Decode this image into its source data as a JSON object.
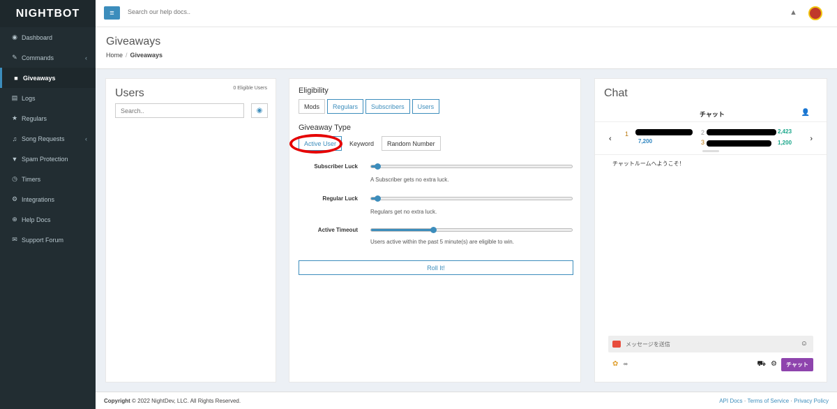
{
  "app": {
    "logo": "NIGHTBOT"
  },
  "header": {
    "search_placeholder": "Search our help docs..",
    "menu_icon": "hamburger-icon",
    "notify_icon": "bell-icon"
  },
  "sidebar": {
    "items": [
      {
        "label": "Dashboard",
        "icon": "dashboard-icon",
        "active": false,
        "has_children": false
      },
      {
        "label": "Commands",
        "icon": "wand-icon",
        "active": false,
        "has_children": true
      },
      {
        "label": "Giveaways",
        "icon": "gift-icon",
        "active": true,
        "has_children": false
      },
      {
        "label": "Logs",
        "icon": "logs-icon",
        "active": false,
        "has_children": false
      },
      {
        "label": "Regulars",
        "icon": "star-icon",
        "active": false,
        "has_children": false
      },
      {
        "label": "Song Requests",
        "icon": "music-icon",
        "active": false,
        "has_children": true
      },
      {
        "label": "Spam Protection",
        "icon": "filter-icon",
        "active": false,
        "has_children": false
      },
      {
        "label": "Timers",
        "icon": "clock-icon",
        "active": false,
        "has_children": false
      },
      {
        "label": "Integrations",
        "icon": "integrations-icon",
        "active": false,
        "has_children": false
      },
      {
        "label": "Help Docs",
        "icon": "globe-icon",
        "active": false,
        "has_children": false
      },
      {
        "label": "Support Forum",
        "icon": "comments-icon",
        "active": false,
        "has_children": false
      }
    ]
  },
  "page": {
    "title": "Giveaways",
    "breadcrumb": [
      "Home",
      "Giveaways"
    ]
  },
  "users_panel": {
    "title": "Users",
    "eligible_count": "0 Eligible Users",
    "search_placeholder": "Search.."
  },
  "giveaway_panel": {
    "eligibility_label": "Eligibility",
    "eligibility_buttons": [
      {
        "label": "Mods",
        "selected": false
      },
      {
        "label": "Regulars",
        "selected": true
      },
      {
        "label": "Subscribers",
        "selected": true
      },
      {
        "label": "Users",
        "selected": true
      }
    ],
    "type_label": "Giveaway Type",
    "type_buttons": [
      {
        "label": "Active User",
        "selected": true
      },
      {
        "label": "Keyword",
        "selected": false
      },
      {
        "label": "Random Number",
        "selected": false
      }
    ],
    "sliders": [
      {
        "label": "Subscriber Luck",
        "value": 0.03,
        "help": "A Subscriber gets no extra luck."
      },
      {
        "label": "Regular Luck",
        "value": 0.03,
        "help": "Regulars get no extra luck."
      },
      {
        "label": "Active Timeout",
        "value": 0.31,
        "help": "Users active within the past 5 minute(s) are eligible to win."
      }
    ],
    "roll_label": "Roll It!"
  },
  "chat_panel": {
    "title": "Chat",
    "header_label": "チャット",
    "leaderboard": [
      {
        "rank": "1",
        "points": "7,200"
      },
      {
        "rank": "2",
        "points": "2,423"
      },
      {
        "rank": "3",
        "points": "1,200"
      }
    ],
    "welcome": "チャットルームへようこそ！",
    "message_placeholder": "メッセージを送信",
    "points_text": "∞",
    "send_label": "チャット"
  },
  "footer": {
    "copyright_label": "Copyright",
    "copyright_text": "© 2022 NightDev, LLC. All Rights Reserved.",
    "links": [
      "API Docs",
      "Terms of Service",
      "Privacy Policy"
    ]
  },
  "colors": {
    "accent": "#3c8dbc",
    "sidebar_bg": "#222d32",
    "annotation": "#e50000",
    "chat_send": "#8e44ad"
  }
}
